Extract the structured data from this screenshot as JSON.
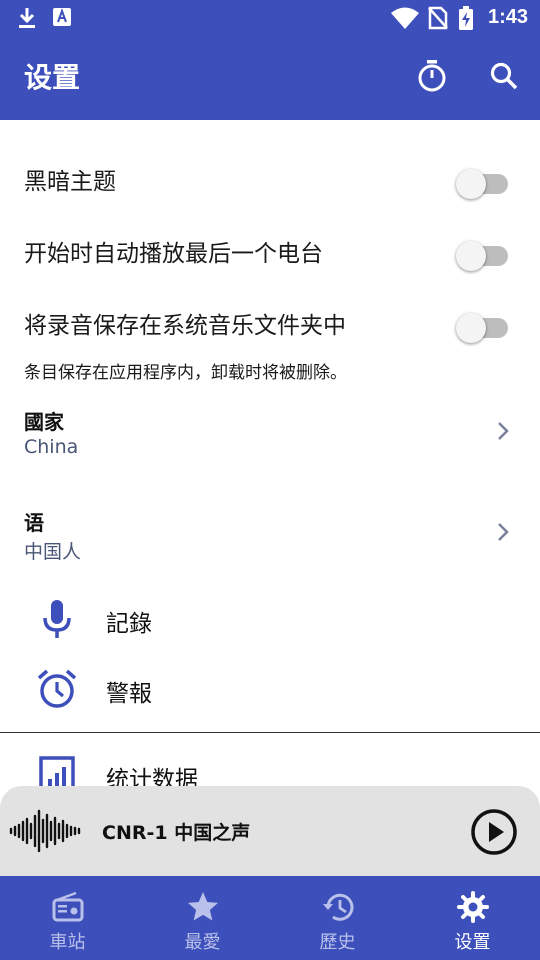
{
  "status_bar": {
    "time": "1:43",
    "icons": [
      "download-icon",
      "text-a-icon",
      "wifi-icon",
      "no-sim-icon",
      "battery-charging-icon"
    ]
  },
  "app_bar": {
    "title": "设置",
    "actions": [
      "timer-icon",
      "search-icon"
    ]
  },
  "settings": {
    "toggles": [
      {
        "label": "黑暗主题",
        "checked": false
      },
      {
        "label": "开始时自动播放最后一个电台",
        "checked": false
      },
      {
        "label": "将录音保存在系统音乐文件夹中",
        "checked": false
      }
    ],
    "save_hint": "条目保存在应用程序内，卸载时将被删除。",
    "country": {
      "title": "國家",
      "value": "China"
    },
    "language": {
      "title": "语",
      "value": "中国人"
    },
    "links": [
      {
        "label": "記錄",
        "icon": "microphone-icon"
      },
      {
        "label": "警報",
        "icon": "alarm-icon"
      },
      {
        "label": "统计数据",
        "icon": "statistics-icon"
      }
    ]
  },
  "player": {
    "station": "CNR-1 中国之声",
    "icon": "play-icon"
  },
  "bottom_nav": {
    "items": [
      {
        "label": "車站",
        "icon": "radio-icon",
        "active": false
      },
      {
        "label": "最愛",
        "icon": "star-icon",
        "active": false
      },
      {
        "label": "歷史",
        "icon": "history-icon",
        "active": false
      },
      {
        "label": "设置",
        "icon": "gear-icon",
        "active": true
      }
    ]
  },
  "colors": {
    "primary": "#3d4fbb",
    "icon_accent": "#3d4fbb",
    "player_bg": "#e2e2e2",
    "secondary_text": "#4a5677",
    "inactive_nav_label": "#b9c0ea"
  }
}
